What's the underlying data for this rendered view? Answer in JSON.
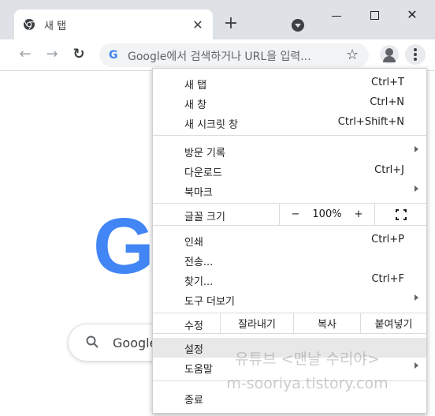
{
  "browser": {
    "tab": {
      "title": "새 탭",
      "close": "✕"
    },
    "new_tab": "+",
    "window": {
      "minimize": "",
      "maximize": "",
      "close": "✕"
    },
    "toolbar": {
      "back": "←",
      "forward": "→",
      "reload": "↻",
      "omnibox_placeholder": "Google에서 검색하거나 URL을 입력...",
      "bookmark_star": "☆"
    }
  },
  "page": {
    "logo_letter": "G",
    "search_text": "Google"
  },
  "menu": {
    "new_tab": {
      "label": "새 탭",
      "shortcut": "Ctrl+T"
    },
    "new_window": {
      "label": "새 창",
      "shortcut": "Ctrl+N"
    },
    "incognito": {
      "label": "새 시크릿 창",
      "shortcut": "Ctrl+Shift+N"
    },
    "history": {
      "label": "방문 기록"
    },
    "downloads": {
      "label": "다운로드",
      "shortcut": "Ctrl+J"
    },
    "bookmarks": {
      "label": "북마크"
    },
    "zoom": {
      "label": "글꼴 크기",
      "minus": "−",
      "value": "100%",
      "plus": "+"
    },
    "print": {
      "label": "인쇄",
      "shortcut": "Ctrl+P"
    },
    "cast": {
      "label": "전송..."
    },
    "find": {
      "label": "찾기...",
      "shortcut": "Ctrl+F"
    },
    "more_tools": {
      "label": "도구 더보기"
    },
    "edit": {
      "label": "수정",
      "cut": "잘라내기",
      "copy": "복사",
      "paste": "붙여넣기"
    },
    "settings": {
      "label": "설정"
    },
    "help": {
      "label": "도움말"
    },
    "exit": {
      "label": "종료"
    }
  },
  "watermark": {
    "line1": "유튜브 <맨날 수리야>",
    "line2": "m-sooriya.tistory.com"
  }
}
